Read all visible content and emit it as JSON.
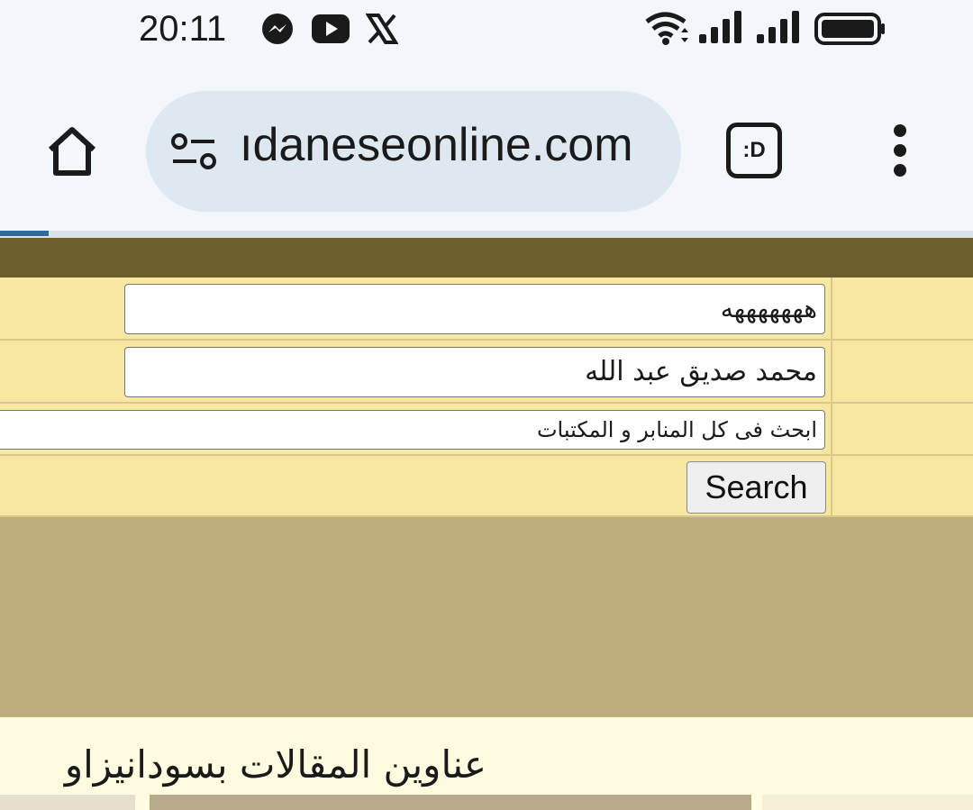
{
  "status_bar": {
    "time": "20:11",
    "notification_icons": [
      "messenger-icon",
      "youtube-icon",
      "x-icon"
    ],
    "system_icons": [
      "wifi-icon",
      "signal-icon",
      "signal-icon",
      "battery-icon"
    ]
  },
  "browser": {
    "url": "ıdaneseonline.com",
    "tabs_label": ":D"
  },
  "page": {
    "colors": {
      "top_band": "#6c5f2d",
      "form_row": "#f8e7a1",
      "tan_band": "#bfae7b",
      "background": "#fefbe0"
    },
    "form": {
      "field1_value": "هههههههه",
      "field2_value": "محمد صديق عبد الله",
      "search_scope_value": "ابحث فى كل المنابر و المكتبات",
      "search_button": "Search"
    },
    "section_heading": "عناوين المقالات بسودانيزاو"
  }
}
